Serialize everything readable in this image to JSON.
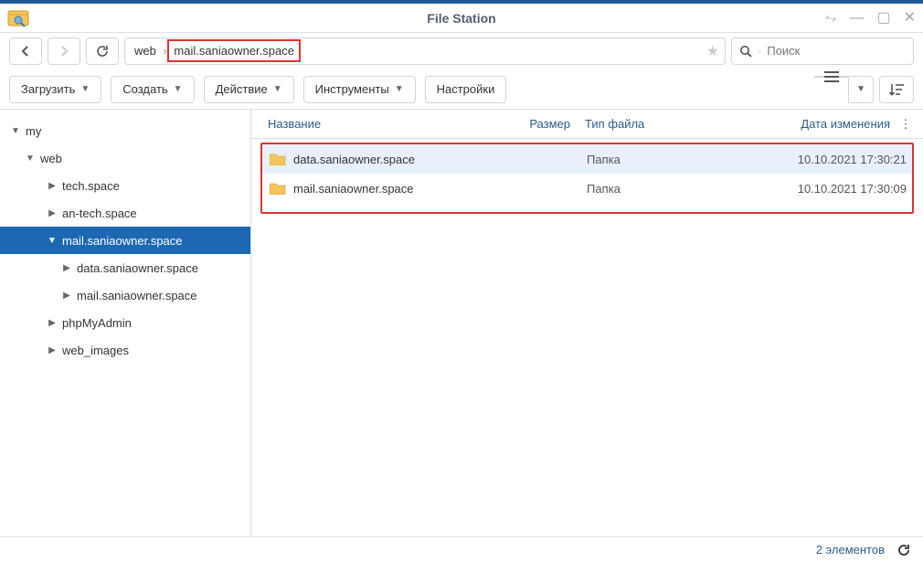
{
  "window": {
    "title": "File Station"
  },
  "navbar": {
    "crumbs": [
      "web",
      "mail.saniaowner.space"
    ],
    "highlight_index": 1,
    "search_placeholder": "Поиск"
  },
  "toolbar": {
    "upload": "Загрузить",
    "create": "Создать",
    "action": "Действие",
    "tools": "Инструменты",
    "settings": "Настройки"
  },
  "tree": [
    {
      "depth": 0,
      "label": "my",
      "twisty": "open",
      "selected": false
    },
    {
      "depth": 1,
      "label": "web",
      "twisty": "open",
      "selected": false
    },
    {
      "depth": 2,
      "label": "tech.space",
      "twisty": "closed",
      "selected": false
    },
    {
      "depth": 2,
      "label": "an-tech.space",
      "twisty": "closed",
      "selected": false
    },
    {
      "depth": 2,
      "label": "mail.saniaowner.space",
      "twisty": "open",
      "selected": true
    },
    {
      "depth": 3,
      "label": "data.saniaowner.space",
      "twisty": "closed",
      "selected": false
    },
    {
      "depth": 3,
      "label": "mail.saniaowner.space",
      "twisty": "closed",
      "selected": false
    },
    {
      "depth": 2,
      "label": "phpMyAdmin",
      "twisty": "closed",
      "selected": false
    },
    {
      "depth": 2,
      "label": "web_images",
      "twisty": "closed",
      "selected": false
    }
  ],
  "columns": {
    "name": "Название",
    "size": "Размер",
    "type": "Тип файла",
    "date": "Дата изменения"
  },
  "rows": [
    {
      "name": "data.saniaowner.space",
      "size": "",
      "type": "Папка",
      "date": "10.10.2021 17:30:21",
      "selected": true
    },
    {
      "name": "mail.saniaowner.space",
      "size": "",
      "type": "Папка",
      "date": "10.10.2021 17:30:09",
      "selected": false
    }
  ],
  "status": {
    "count_text": "2 элементов"
  }
}
